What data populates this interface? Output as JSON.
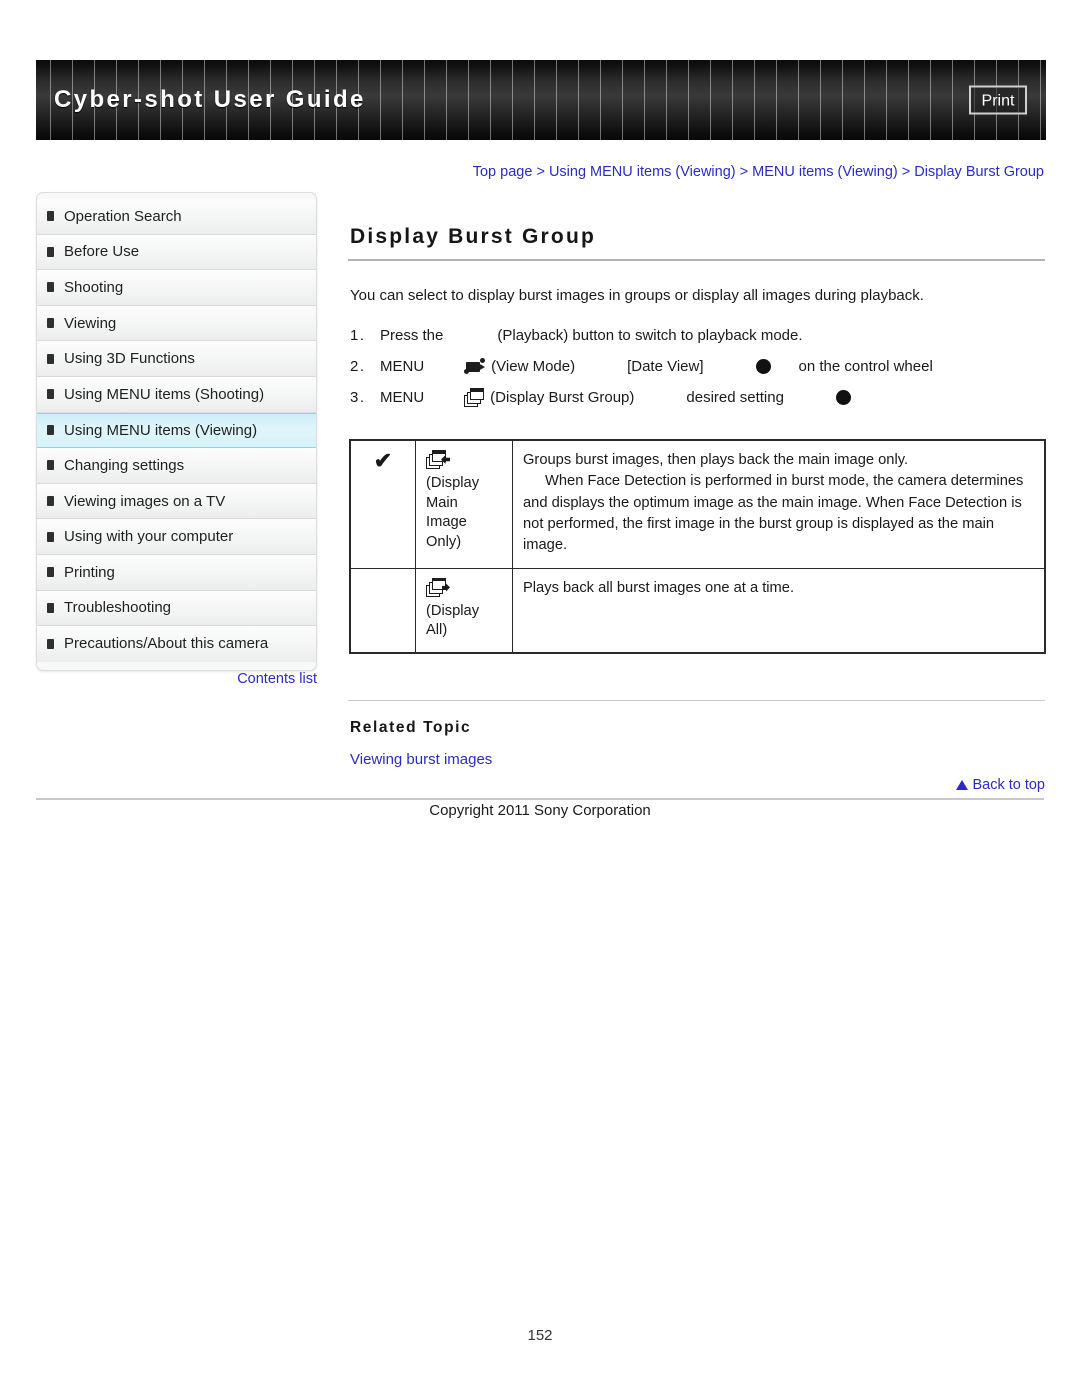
{
  "header": {
    "title": "Cyber-shot User Guide",
    "print_label": "Print"
  },
  "breadcrumb": {
    "separator": ">",
    "items": [
      "Top page",
      "Using MENU items (Viewing)",
      "MENU items (Viewing)",
      "Display Burst Group"
    ]
  },
  "sidebar": {
    "items": [
      {
        "label": "Operation Search",
        "active": false
      },
      {
        "label": "Before Use",
        "active": false
      },
      {
        "label": "Shooting",
        "active": false
      },
      {
        "label": "Viewing",
        "active": false
      },
      {
        "label": "Using 3D Functions",
        "active": false
      },
      {
        "label": "Using MENU items (Shooting)",
        "active": false
      },
      {
        "label": "Using MENU items (Viewing)",
        "active": true
      },
      {
        "label": "Changing settings",
        "active": false
      },
      {
        "label": "Viewing images on a TV",
        "active": false
      },
      {
        "label": "Using with your computer",
        "active": false
      },
      {
        "label": "Printing",
        "active": false
      },
      {
        "label": "Troubleshooting",
        "active": false
      },
      {
        "label": "Precautions/About this camera",
        "active": false
      }
    ],
    "contents_list_label": "Contents list"
  },
  "main": {
    "title": "Display Burst Group",
    "intro": "You can select to display burst images in groups or display all images during playback.",
    "steps": [
      {
        "number": "1.",
        "text_before": "Press the",
        "icon": "playback-icon-missing",
        "text_after": "(Playback) button to switch to playback mode.",
        "tail": ""
      },
      {
        "number": "2.",
        "text_before": "MENU",
        "icon": "view-mode-icon",
        "text_after": "(View Mode)",
        "bracket": "[Date View]",
        "dot": "control-wheel-center-button",
        "tail": "on the control wheel"
      },
      {
        "number": "3.",
        "text_before": "MENU",
        "icon": "display-burst-group-icon",
        "text_after": "(Display Burst Group)",
        "bracket": "desired setting",
        "dot": "control-wheel-center-button",
        "tail": ""
      }
    ],
    "table": {
      "rows": [
        {
          "checked": true,
          "check_glyph": "✔",
          "icon": "stack-arrow-left-icon",
          "option_name": "(Display Main Image Only)",
          "desc_line1": "Groups burst images, then plays back the main image only.",
          "desc_line2": "When Face Detection is performed in burst mode, the camera determines and displays the optimum image as the main image. When Face Detection is not performed, the first image in the burst group is displayed as the main image."
        },
        {
          "checked": false,
          "check_glyph": "",
          "icon": "stack-arrow-right-icon",
          "option_name": "(Display All)",
          "desc_line1": "Plays back all burst images one at a time.",
          "desc_line2": ""
        }
      ]
    },
    "related": {
      "heading": "Related Topic",
      "links": [
        "Viewing burst images"
      ]
    }
  },
  "footer": {
    "back_to_top": "Back to top",
    "copyright": "Copyright 2011 Sony Corporation",
    "page_number": "152"
  },
  "colors": {
    "link": "#2b2bc4",
    "banner_bg": "#1e1e1e",
    "active_nav": "#d6f2fa",
    "rule": "#b3b3b3"
  }
}
